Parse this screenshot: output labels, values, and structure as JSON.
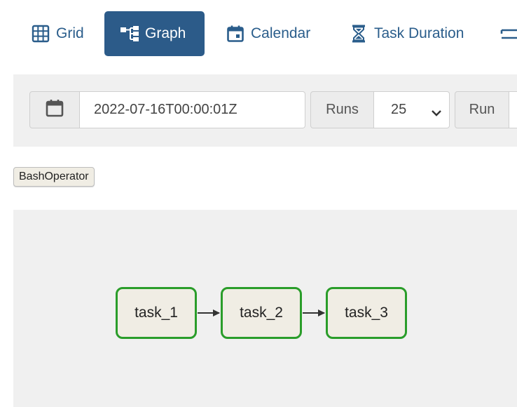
{
  "tabs": [
    {
      "label": "Grid",
      "icon": "grid-icon",
      "active": false
    },
    {
      "label": "Graph",
      "icon": "graph-icon",
      "active": true
    },
    {
      "label": "Calendar",
      "icon": "calendar-icon",
      "active": false
    },
    {
      "label": "Task Duration",
      "icon": "hourglass-icon",
      "active": false
    },
    {
      "label": "",
      "icon": "swap-icon",
      "active": false
    }
  ],
  "controls": {
    "date_icon": "calendar-icon",
    "date_value": "2022-07-16T00:00:01Z",
    "runs_label": "Runs",
    "runs_value": "25",
    "run_label": "Run"
  },
  "legend": {
    "operators": [
      "BashOperator"
    ]
  },
  "graph": {
    "nodes": [
      "task_1",
      "task_2",
      "task_3"
    ],
    "edges": [
      [
        "task_1",
        "task_2"
      ],
      [
        "task_2",
        "task_3"
      ]
    ]
  },
  "colors": {
    "accent": "#2c5b89",
    "link": "#2a5d8b",
    "node_border_success": "#2a9d2a",
    "node_fill": "#f0ede4",
    "panel_bg": "#f0f0f0"
  }
}
